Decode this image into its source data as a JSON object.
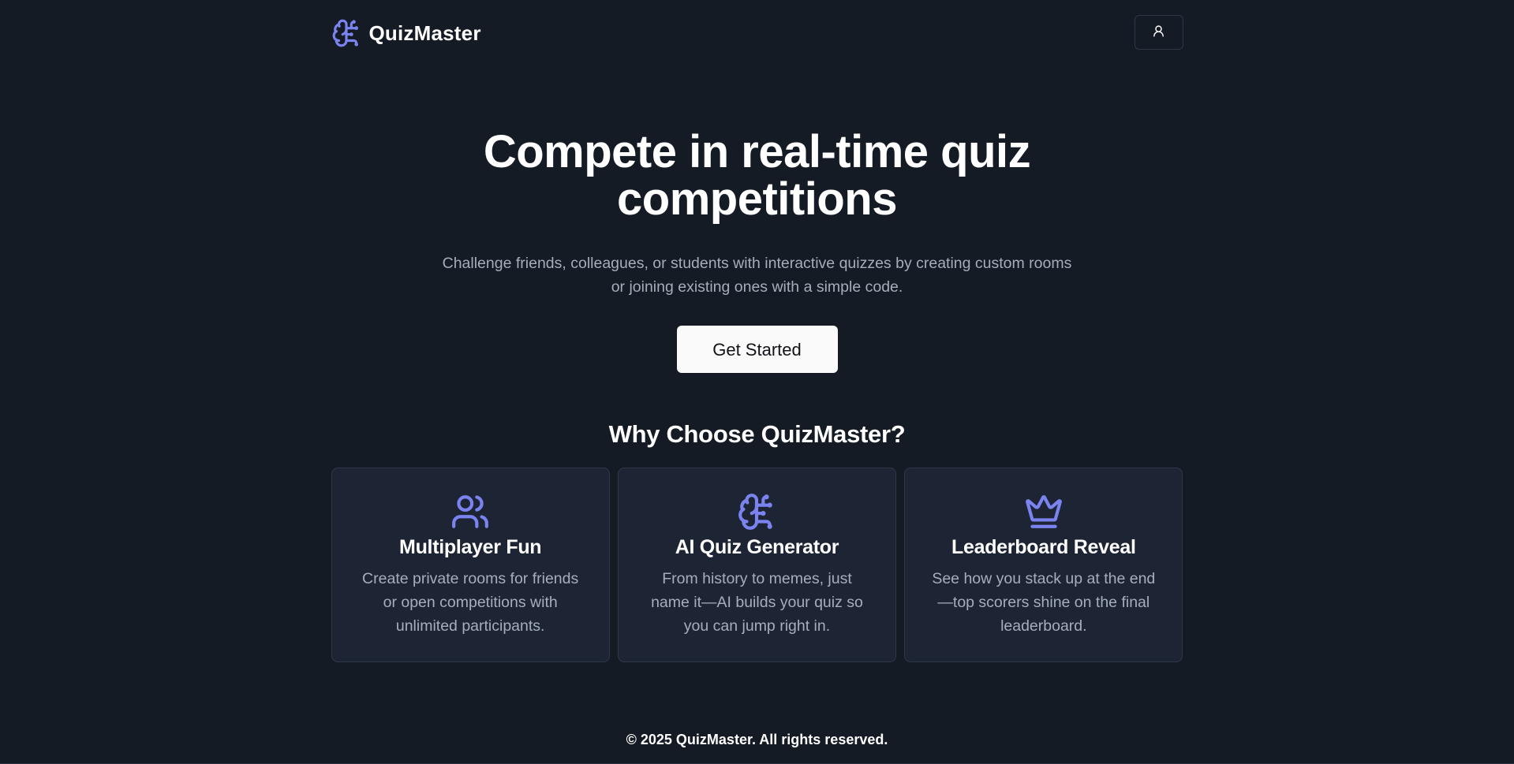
{
  "header": {
    "brand_name": "QuizMaster",
    "brand_icon": "brain-icon",
    "account_icon": "user-icon"
  },
  "hero": {
    "title": "Compete in real-time quiz competitions",
    "subtitle": "Challenge friends, colleagues, or students with interactive quizzes by creating custom rooms or joining existing ones with a simple code.",
    "cta_label": "Get Started"
  },
  "features": {
    "title": "Why Choose QuizMaster?",
    "items": [
      {
        "icon": "users-icon",
        "title": "Multiplayer Fun",
        "description": "Create private rooms for friends or open competitions with unlimited participants."
      },
      {
        "icon": "brain-icon",
        "title": "AI Quiz Generator",
        "description": "From history to memes, just name it—AI builds your quiz so you can jump right in."
      },
      {
        "icon": "crown-icon",
        "title": "Leaderboard Reveal",
        "description": "See how you stack up at the end—top scorers shine on the final leaderboard."
      }
    ]
  },
  "footer": {
    "copyright": "© 2025 QuizMaster. All rights reserved."
  },
  "colors": {
    "background": "#151b24",
    "card_background": "#1d2535",
    "accent": "#7b83f0",
    "muted_text": "#a6adbb",
    "button_background": "#fafafa"
  }
}
